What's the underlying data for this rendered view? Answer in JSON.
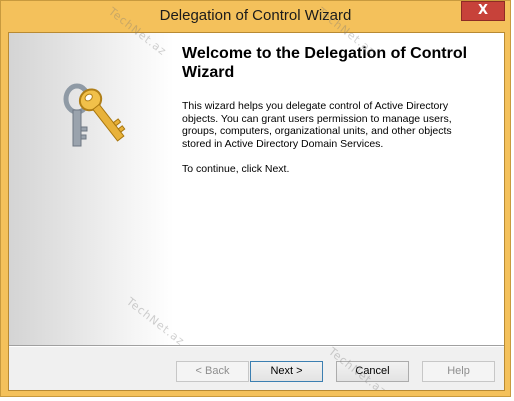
{
  "window": {
    "title": "Delegation of Control Wizard",
    "close_label": "X"
  },
  "wizard": {
    "heading": "Welcome to the Delegation of Control Wizard",
    "body": "This wizard helps you delegate control of Active Directory objects. You can grant users permission to manage users, groups, computers, organizational units, and other objects stored in Active Directory Domain Services.",
    "continue": "To continue, click Next."
  },
  "buttons": {
    "back": "< Back",
    "next": "Next >",
    "cancel": "Cancel",
    "help": "Help"
  },
  "icons": {
    "keys": "keys-icon",
    "close": "close-icon"
  },
  "watermark": "TechNet.az",
  "colors": {
    "title_bar": "#f4c15b",
    "close_button": "#c7423a",
    "key_gold": "#e8b23a",
    "key_silver": "#9aa3ad"
  }
}
